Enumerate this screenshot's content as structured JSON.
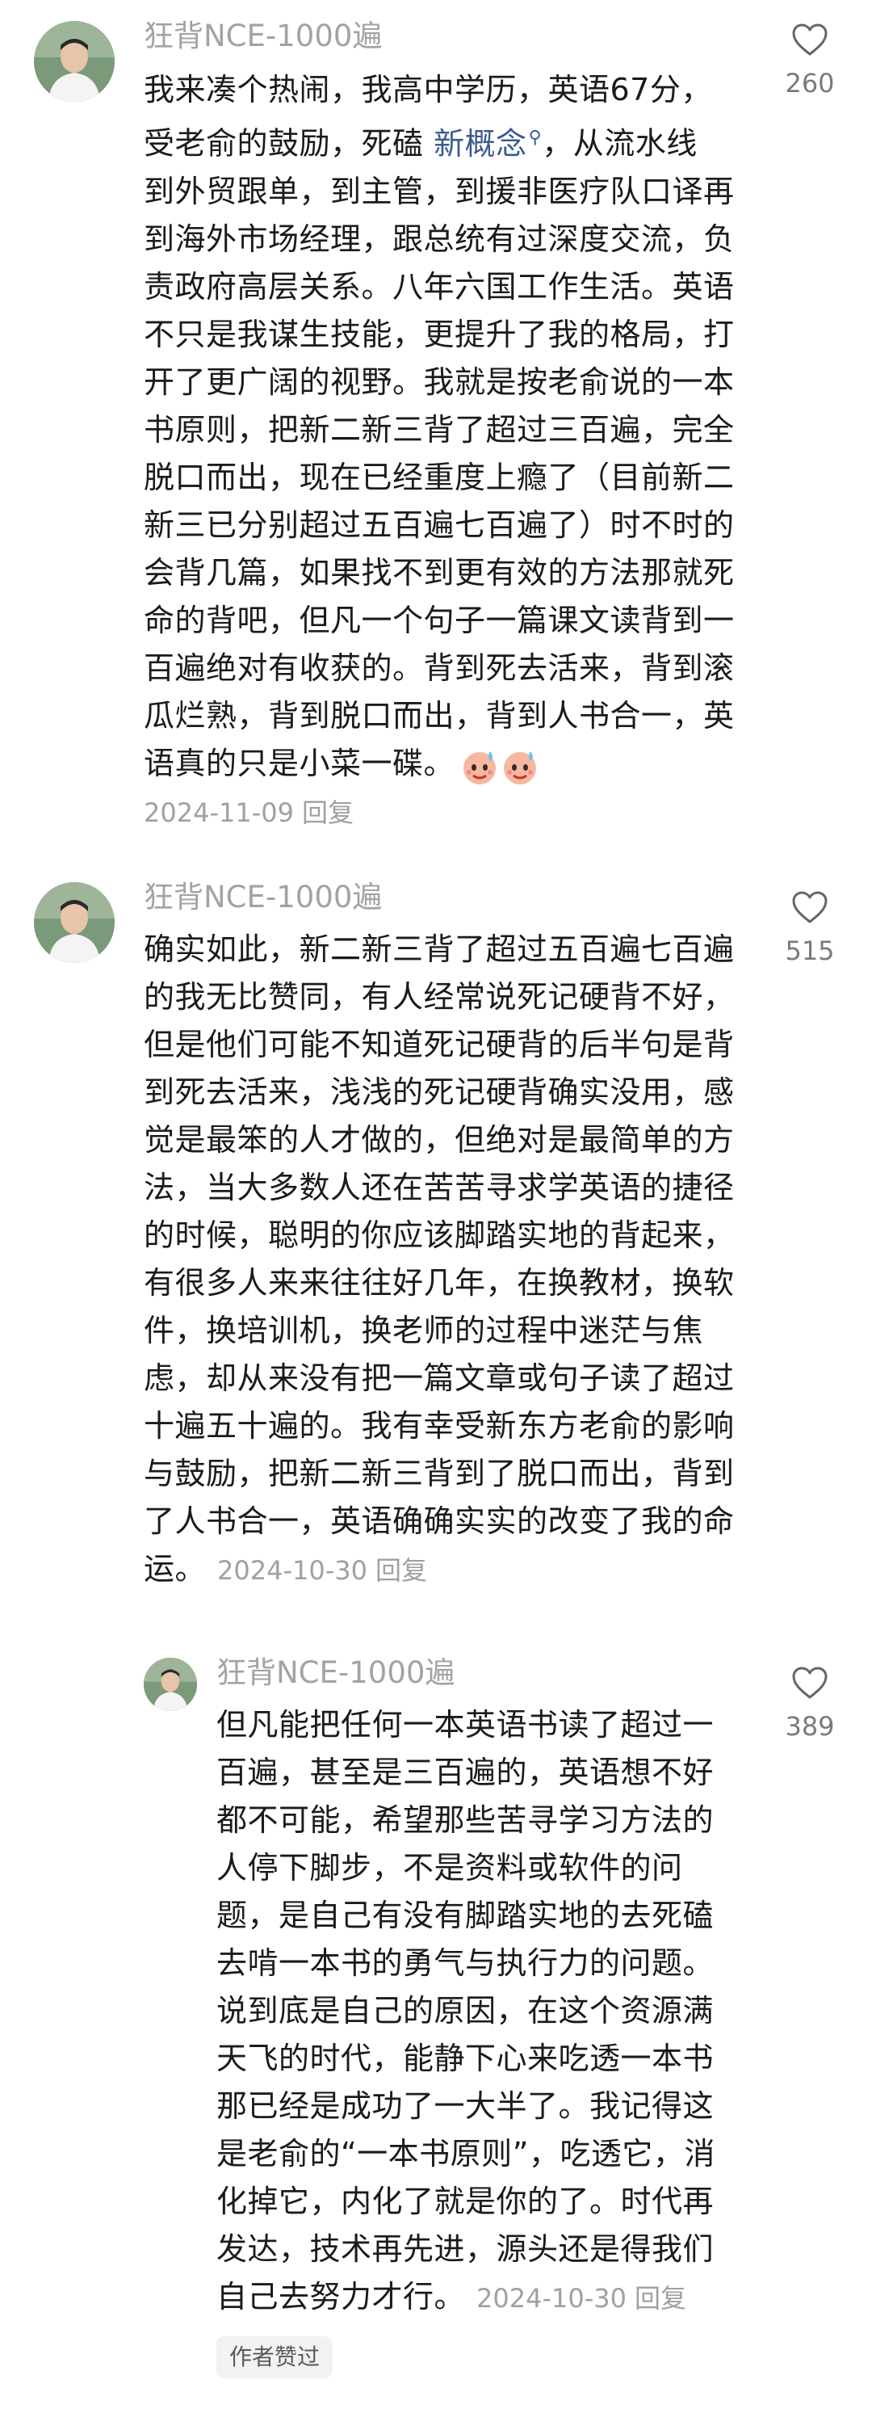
{
  "comments": [
    {
      "username": "狂背NCE-1000遍",
      "lines_before_keyword": [
        "我来凑个热闹，我高中学历，英语67分，"
      ],
      "line2_prefix": "受老俞的鼓励，死磕 ",
      "keyword": "新概念",
      "line2_suffix": "，从流水线",
      "lines": [
        "到外贸跟单，到主管，到援非医疗队口译再",
        "到海外市场经理，跟总统有过深度交流，负",
        "责政府高层关系。八年六国工作生活。英语",
        "不只是我谋生技能，更提升了我的格局，打",
        "开了更广阔的视野。我就是按老俞说的一本",
        "书原则，把新二新三背了超过三百遍，完全",
        "脱口而出，现在已经重度上瘾了（目前新二",
        "新三已分别超过五百遍七百遍了）时不时的",
        "会背几篇，如果找不到更有效的方法那就死",
        "命的背吧，但凡一个句子一篇课文读背到一",
        "百遍绝对有收获的。背到死去活来，背到滚",
        "瓜烂熟，背到脱口而出，背到人书合一，英"
      ],
      "last_line": "语真的只是小菜一碟。",
      "date": "2024-11-09",
      "reply_label": "回复",
      "likes": "260",
      "emoji": "sweat-smile-emoji"
    },
    {
      "username": "狂背NCE-1000遍",
      "lines": [
        "确实如此，新二新三背了超过五百遍七百遍",
        "的我无比赞同，有人经常说死记硬背不好，",
        "但是他们可能不知道死记硬背的后半句是背",
        "到死去活来，浅浅的死记硬背确实没用，感",
        "觉是最笨的人才做的，但绝对是最简单的方",
        "法，当大多数人还在苦苦寻求学英语的捷径",
        "的时候，聪明的你应该脚踏实地的背起来，",
        "有很多人来来往往好几年，在换教材，换软",
        "件，换培训机，换老师的过程中迷茫与焦",
        "虑，却从来没有把一篇文章或句子读了超过",
        "十遍五十遍的。我有幸受新东方老俞的影响",
        "与鼓励，把新二新三背到了脱口而出，背到",
        "了人书合一，英语确确实实的改变了我的命"
      ],
      "last_line": "运。",
      "date": "2024-10-30",
      "reply_label": "回复",
      "likes": "515"
    },
    {
      "username": "狂背NCE-1000遍",
      "lines": [
        "但凡能把任何一本英语书读了超过一",
        "百遍，甚至是三百遍的，英语想不好",
        "都不可能，希望那些苦寻学习方法的",
        "人停下脚步，不是资料或软件的问",
        "题，是自己有没有脚踏实地的去死磕",
        "去啃一本书的勇气与执行力的问题。",
        "说到底是自己的原因，在这个资源满",
        "天飞的时代，能静下心来吃透一本书",
        "那已经是成功了一大半了。我记得这",
        "是老俞的“一本书原则”，吃透它，消",
        "化掉它，内化了就是你的了。时代再",
        "发达，技术再先进，源头还是得我们"
      ],
      "last_line": "自己去努力才行。",
      "date": "2024-10-30",
      "reply_label": "回复",
      "likes": "389",
      "badge": "作者赞过"
    }
  ],
  "colors": {
    "username": "#a3a3a3",
    "body": "#1b1b1b",
    "meta": "#a0a0a0",
    "keyword": "#3b5b8f",
    "badge_bg": "#f2f2f2"
  }
}
